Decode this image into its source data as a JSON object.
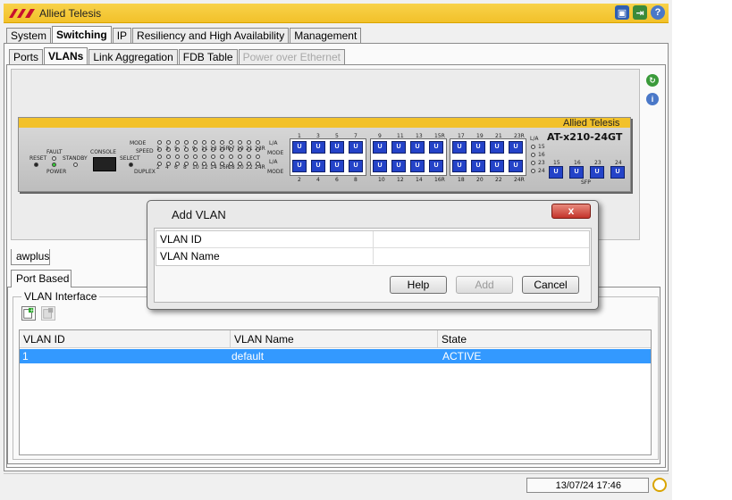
{
  "app": {
    "title": "Allied Telesis",
    "logo_text": "ATI"
  },
  "title_icons": [
    "save-icon",
    "logout-icon",
    "help-icon"
  ],
  "main_tabs": [
    {
      "label": "System",
      "active": false
    },
    {
      "label": "Switching",
      "active": true
    },
    {
      "label": "IP",
      "active": false
    },
    {
      "label": "Resiliency and High Availability",
      "active": false
    },
    {
      "label": "Management",
      "active": false
    }
  ],
  "sub_tabs": [
    {
      "label": "Ports",
      "active": false
    },
    {
      "label": "VLANs",
      "active": true
    },
    {
      "label": "Link Aggregation",
      "active": false
    },
    {
      "label": "FDB Table",
      "active": false
    },
    {
      "label": "Power over Ethernet",
      "active": false,
      "disabled": true
    }
  ],
  "device": {
    "brand": "Allied Telesis",
    "model": "AT-x210-24GT",
    "labels": {
      "reset": "RESET",
      "fault": "FAULT",
      "standby": "STANDBY",
      "power": "POWER",
      "console": "CONSOLE",
      "mode": "MODE",
      "speed": "SPEED",
      "select": "SELECT",
      "duplex": "DUPLEX",
      "la": "L/A",
      "mode2": "MODE",
      "sfp": "SFP"
    },
    "port_top_numbers": [
      "1",
      "3",
      "5",
      "7",
      "9",
      "11",
      "13",
      "15R",
      "17",
      "19",
      "21",
      "23R"
    ],
    "port_bottom_numbers": [
      "2",
      "4",
      "6",
      "8",
      "10",
      "12",
      "14",
      "16R",
      "18",
      "20",
      "22",
      "24R"
    ],
    "sfp_numbers": [
      "15",
      "16",
      "23",
      "24"
    ],
    "sfp_led_labels": [
      "15",
      "16",
      "23",
      "24"
    ],
    "port_glyph": "U"
  },
  "side_icons": [
    "refresh-icon",
    "info-icon"
  ],
  "awplus_tab": "awplus",
  "port_based_tab": "Port Based",
  "vlan_interface": {
    "label": "VLAN Interface",
    "columns": [
      "VLAN ID",
      "VLAN Name",
      "State"
    ],
    "rows": [
      {
        "id": "1",
        "name": "default",
        "state": "ACTIVE",
        "selected": true
      }
    ]
  },
  "status": {
    "datetime": "13/07/24 17:46"
  },
  "dialog": {
    "title": "Add VLAN",
    "close_label": "x",
    "fields": [
      {
        "label": "VLAN ID",
        "value": ""
      },
      {
        "label": "VLAN Name",
        "value": ""
      }
    ],
    "buttons": {
      "help": "Help",
      "add": "Add",
      "cancel": "Cancel"
    }
  },
  "colors": {
    "brand_yellow": "#f2c12a",
    "selection": "#3399ff",
    "port_blue": "#2443c8",
    "close_red": "#c3342b"
  }
}
